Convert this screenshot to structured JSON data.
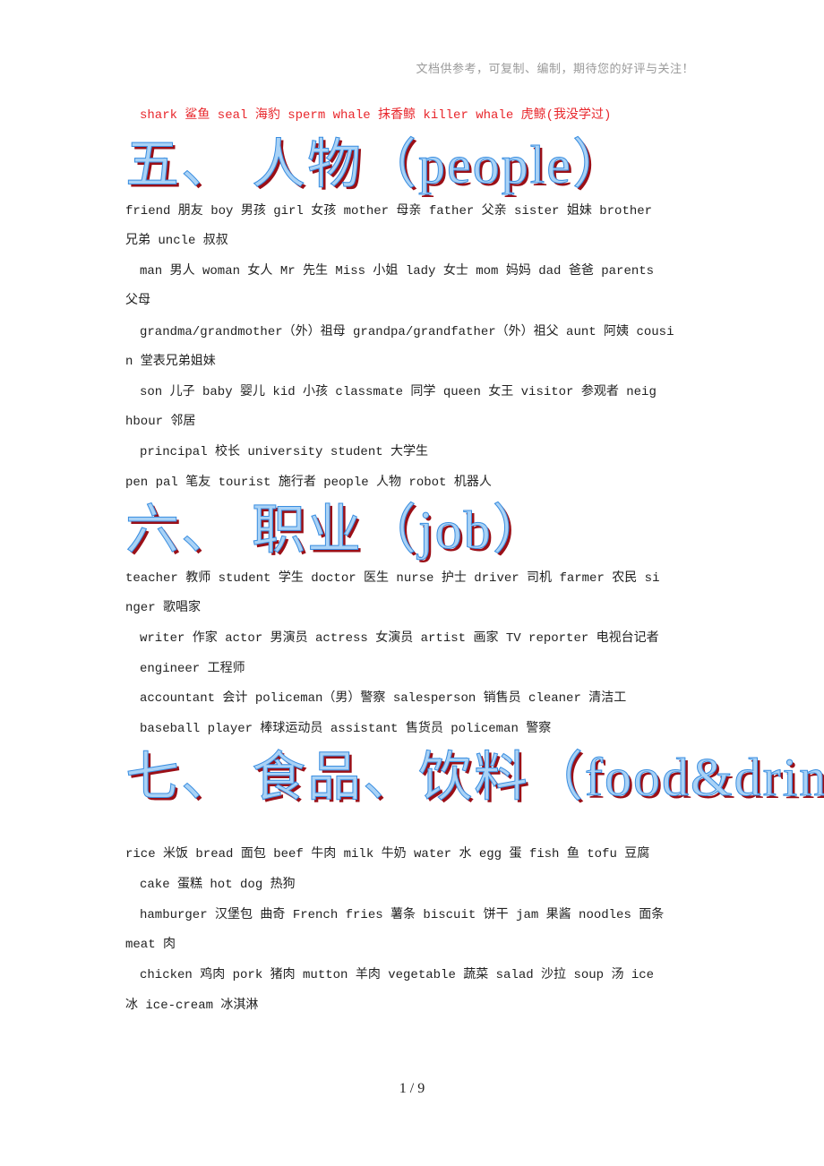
{
  "header_note": "文档供参考，可复制、编制，期待您的好评与关注！",
  "lines": {
    "sea_animals": "shark 鲨鱼  seal 海豹  sperm whale 抹香鲸  killer whale 虎鲸(我没学过)",
    "people_1a": "friend 朋友  boy 男孩  girl 女孩  mother 母亲  father 父亲  sister 姐妹  brother",
    "people_1b": "兄弟  uncle 叔叔",
    "people_2a": "man 男人  woman 女人  Mr 先生  Miss 小姐  lady 女士  mom 妈妈  dad 爸爸  parents",
    "people_2b": "父母",
    "people_3a": "grandma/grandmother（外）祖母  grandpa/grandfather（外）祖父  aunt 阿姨  cousi",
    "people_3b": "n 堂表兄弟姐妹",
    "people_4a": "son 儿子  baby 婴儿  kid 小孩  classmate 同学  queen 女王  visitor 参观者  neig",
    "people_4b": "hbour 邻居",
    "people_5": "principal 校长  university student 大学生",
    "people_6": "pen pal 笔友  tourist 施行者  people 人物  robot 机器人",
    "job_1a": "teacher 教师  student 学生  doctor 医生  nurse 护士  driver 司机  farmer 农民  si",
    "job_1b": "nger 歌唱家",
    "job_2": "writer 作家  actor 男演员  actress 女演员  artist 画家  TV reporter 电视台记者",
    "job_3": "engineer 工程师",
    "job_4": "accountant 会计  policeman（男）警察  salesperson 销售员  cleaner 清洁工",
    "job_5": "baseball player 棒球运动员  assistant 售货员  policeman 警察",
    "food_1": "rice 米饭  bread 面包  beef 牛肉  milk 牛奶  water 水  egg 蛋  fish 鱼  tofu 豆腐",
    "food_2": "cake 蛋糕  hot dog 热狗",
    "food_3a": "hamburger 汉堡包  曲奇 French fries 薯条  biscuit 饼干  jam 果酱  noodles 面条",
    "food_3b": "meat 肉",
    "food_4a": "chicken 鸡肉  pork 猪肉  mutton 羊肉  vegetable 蔬菜  salad 沙拉  soup 汤  ice",
    "food_4b": "冰  ice-cream 冰淇淋"
  },
  "headings": {
    "people": "五、 人物（people）",
    "job": "六、 职业（job）",
    "food": "七、 食品、饮料（food&drink）"
  },
  "colors": {
    "red_text": "#e8262b",
    "heading_fill": "#a9d2f6",
    "heading_stroke": "#3a8ee0",
    "heading_shadow": "#9b0f17"
  },
  "page_number": "1 / 9"
}
